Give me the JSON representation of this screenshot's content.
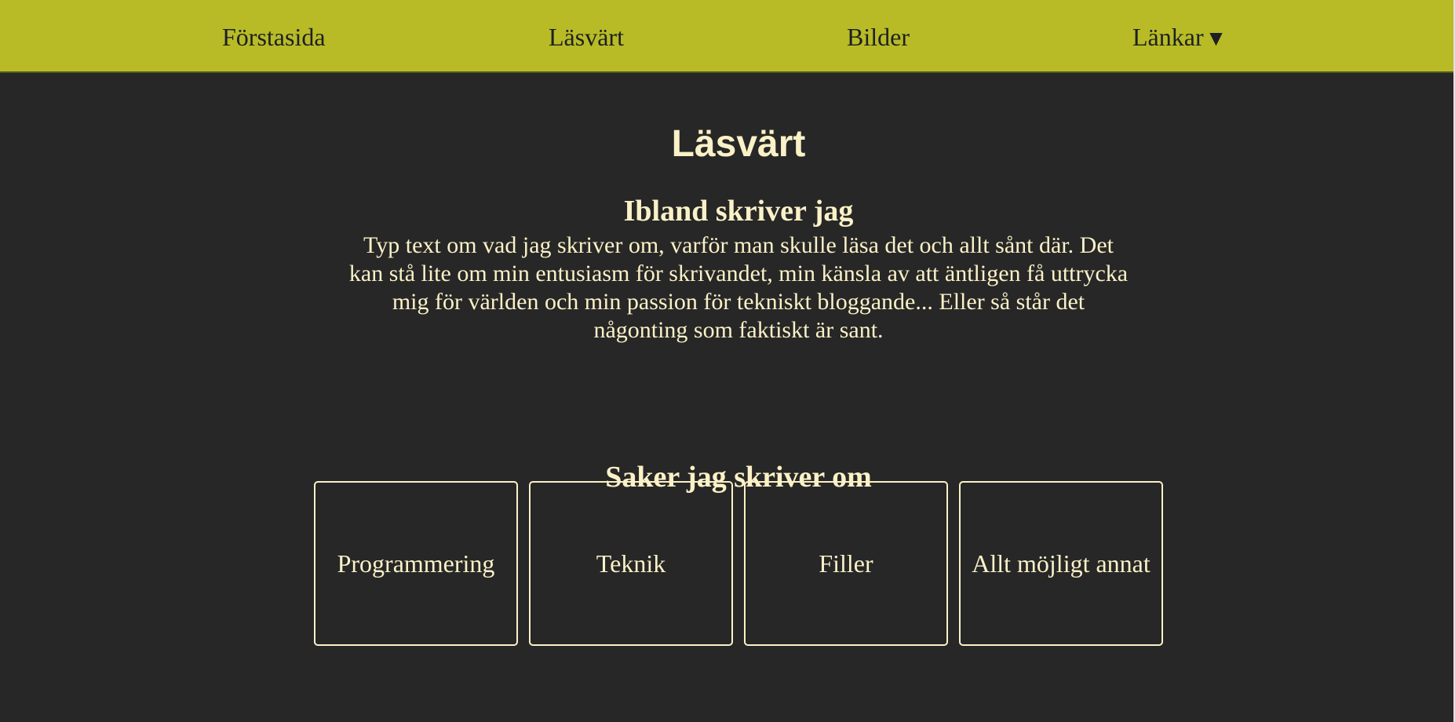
{
  "nav": {
    "items": [
      {
        "label": "Förstasida"
      },
      {
        "label": "Läsvärt"
      },
      {
        "label": "Bilder"
      },
      {
        "label": "Länkar",
        "icon": "caret-down-icon",
        "icon_glyph": "▼"
      }
    ]
  },
  "main": {
    "title": "Läsvärt",
    "intro": {
      "heading": "Ibland skriver jag",
      "text": "Typ text om vad jag skriver om, varför man skulle läsa det och allt sånt där. Det kan stå lite om min entusiasm för skrivandet, min känsla av att äntligen få uttrycka mig för världen och min passion för tekniskt bloggande... Eller så står det någonting som faktiskt är sant."
    },
    "topics": {
      "heading": "Saker jag skriver om",
      "cards": [
        {
          "label": "Programmering"
        },
        {
          "label": "Teknik"
        },
        {
          "label": "Filler"
        },
        {
          "label": "Allt möjligt annat"
        }
      ]
    }
  },
  "colors": {
    "navbar_bg": "#b8bb26",
    "page_bg": "#272727",
    "text": "#fbf1c7",
    "nav_text": "#1d2021"
  }
}
